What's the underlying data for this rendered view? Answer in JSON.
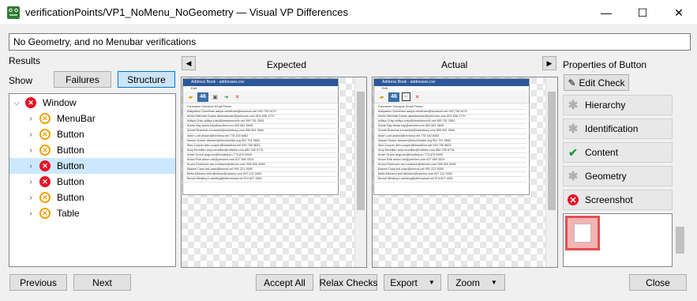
{
  "window": {
    "title": "verificationPoints/VP1_NoMenu_NoGeometry  — Visual VP Differences",
    "minimize_glyph": "—",
    "maximize_glyph": "☐",
    "close_glyph": "✕"
  },
  "description": "No Geometry, and no Menubar verifications",
  "results": {
    "label": "Results",
    "show_label": "Show",
    "failures_button": "Failures",
    "structure_button": "Structure",
    "tree": [
      {
        "label": "Window",
        "status": "error",
        "expanded": true
      },
      {
        "label": "MenuBar",
        "status": "warning"
      },
      {
        "label": "Button",
        "status": "warning"
      },
      {
        "label": "Button",
        "status": "warning"
      },
      {
        "label": "Button",
        "status": "error",
        "selected": true
      },
      {
        "label": "Button",
        "status": "error"
      },
      {
        "label": "Button",
        "status": "warning"
      },
      {
        "label": "Table",
        "status": "warning"
      }
    ]
  },
  "comparison": {
    "expected_label": "Expected",
    "actual_label": "Actual",
    "prev_arrow": "◀",
    "next_arrow": "▶",
    "mini_app": {
      "title": "Address Book - addresses.csv",
      "menu": "Edit",
      "tool_label": "46",
      "columns": [
        "Forename",
        "Surname",
        "Email",
        "Phone"
      ],
      "rows": [
        [
          "Aaliyasha",
          "Cheetham",
          "aaliya.cheetham@shoeson.net",
          "943 799 9479"
        ],
        [
          "Abdul-Wahhab",
          "Dodse",
          "abdulsdodse@yetonom.com",
          "891 836 1779"
        ],
        [
          "Aditya",
          "Crisp",
          "aditya.crisp@beaskernorth.net",
          "995 761 2963"
        ],
        [
          "Adula",
          "Hay",
          "adula.hay@aoclew.com",
          "563 581 4845"
        ],
        [
          "Ahmet",
          "Bramhal",
          "a.bramhal@solenborg.com",
          "596 961 5584"
        ],
        [
          "Aiste",
          "Lord",
          "aisturd@heritony.net",
          "778 163 8462"
        ],
        [
          "Alavan",
          "Dower",
          "aldower@leechholder.org",
          "951 751 9660"
        ],
        [
          "Alex",
          "Cooper",
          "alex.cooper@blassblow.net",
          "539 765 9823"
        ],
        [
          "Amy",
          "Mcmillan",
          "amy.mcmillan@robbies.com",
          "880 226 6776"
        ],
        [
          "Anish",
          "Grove",
          "angrove@fmultely.eu",
          "773 879 9999"
        ],
        [
          "Anton",
          "Rob",
          "anton.rob@yerslinn.com",
          "627 859 3324"
        ],
        [
          "Aruna",
          "Rohrbach",
          "aru.rohrbach@stevoin.com",
          "556 500 3056"
        ],
        [
          "Basant",
          "Caan",
          "bal.caan@timmsi.net",
          "990 221 9559"
        ],
        [
          "Bella",
          "Atkinson",
          "bell.atkinson@cammy.com",
          "507 112 3453"
        ],
        [
          "Benoit",
          "Westing",
          "b.westing@ctlemcaval.net",
          "574 607 4831"
        ]
      ]
    }
  },
  "properties": {
    "title": "Properties of Button",
    "edit_check": "Edit Check",
    "items": [
      {
        "label": "Hierarchy",
        "state": "neutral"
      },
      {
        "label": "Identification",
        "state": "neutral"
      },
      {
        "label": "Content",
        "state": "pass"
      },
      {
        "label": "Geometry",
        "state": "neutral"
      },
      {
        "label": "Screenshot",
        "state": "fail"
      }
    ]
  },
  "footer": {
    "previous": "Previous",
    "next": "Next",
    "accept_all": "Accept All",
    "relax_checks": "Relax Checks",
    "export": "Export",
    "zoom": "Zoom",
    "close": "Close"
  },
  "colors": {
    "error": "#e81123",
    "warning": "#f0a30a",
    "pass": "#1e9c3a",
    "selection": "#cce8ff",
    "accent": "#0078d7"
  }
}
